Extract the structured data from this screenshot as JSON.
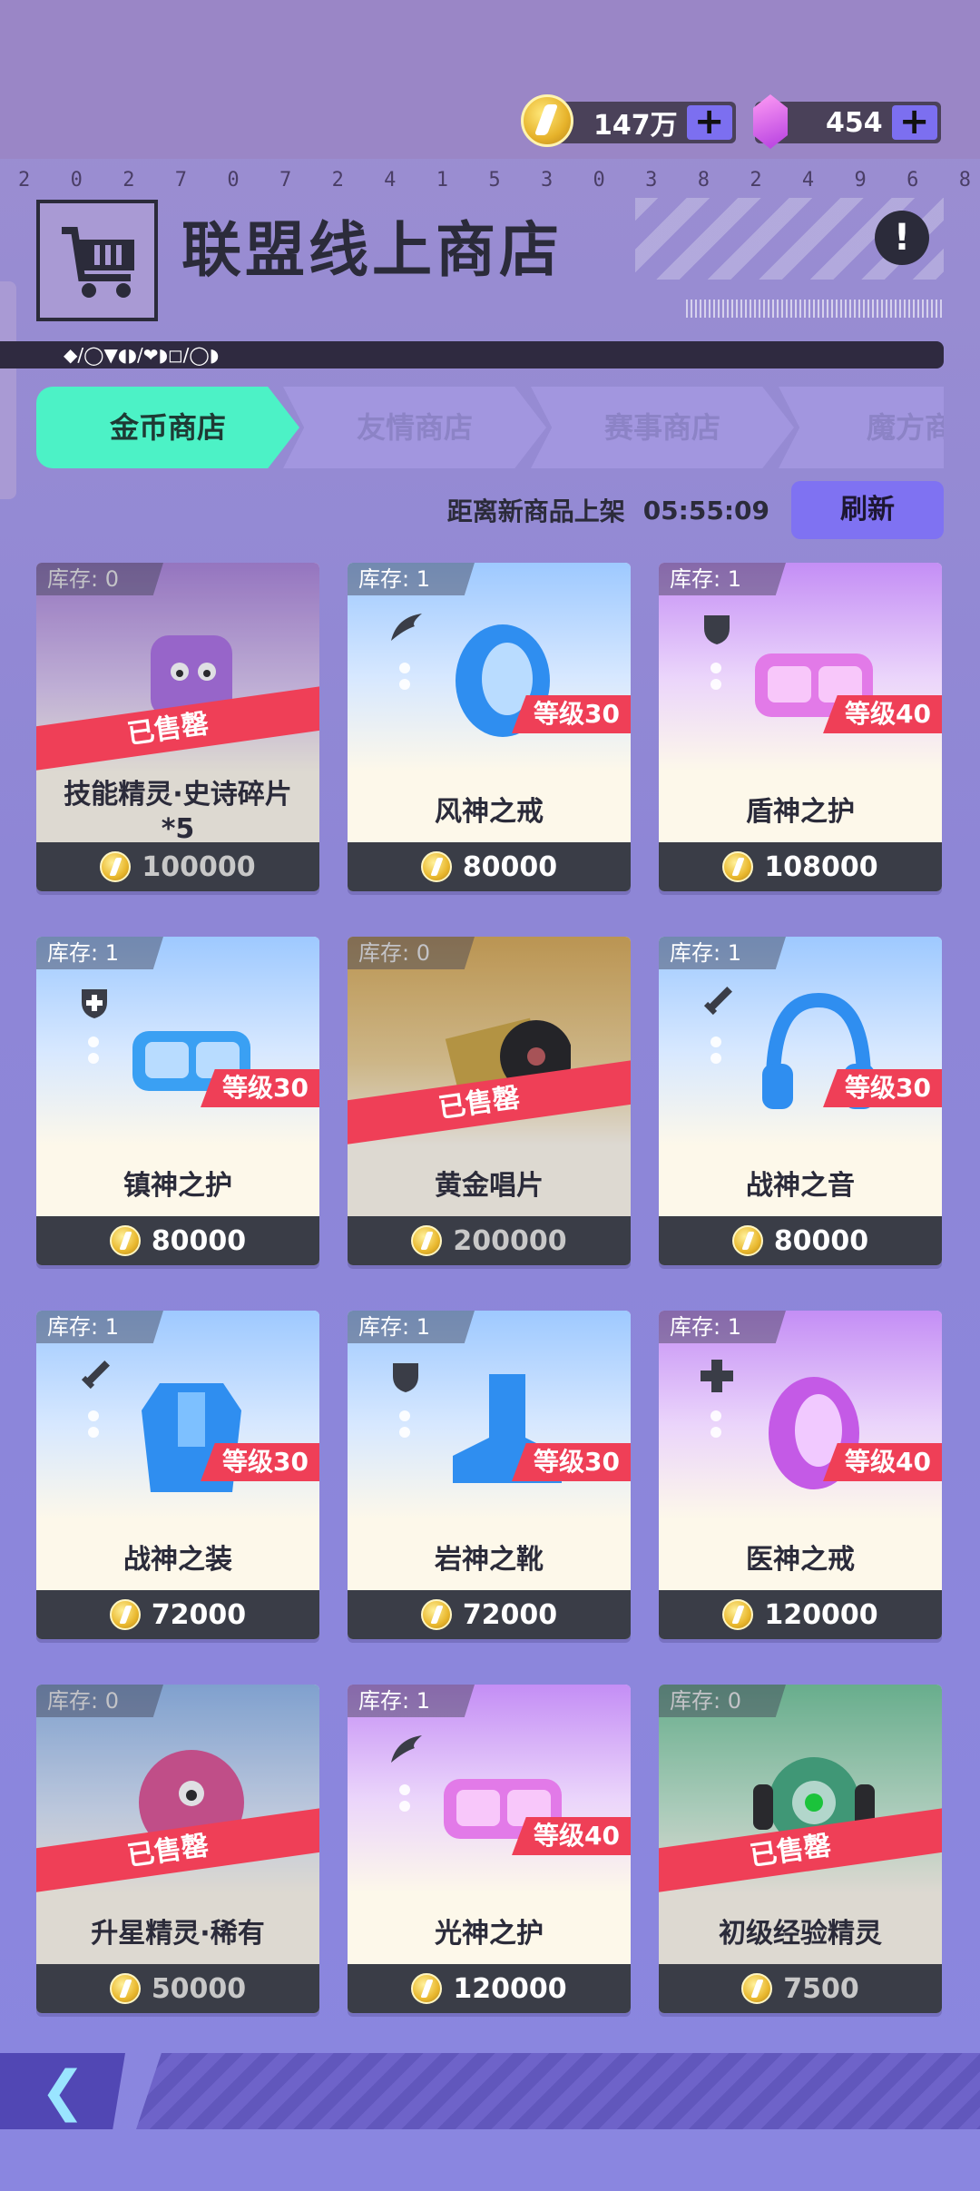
{
  "header": {
    "coins": "147万",
    "gems": "454",
    "serial_digits": [
      "2",
      "0",
      "2",
      "7",
      "0",
      "7",
      "2",
      "4",
      "1",
      "5",
      "3",
      "0",
      "3",
      "8",
      "2",
      "4",
      "9",
      "6",
      "8"
    ],
    "title": "联盟线上商店",
    "symbol_strip": "◆/◯▼◖◗/❤◗◻/◯◗"
  },
  "tabs": [
    {
      "label": "金币商店",
      "active": true
    },
    {
      "label": "友情商店",
      "active": false
    },
    {
      "label": "赛事商店",
      "active": false
    },
    {
      "label": "魔方商",
      "active": false
    }
  ],
  "refresh": {
    "label": "距离新商品上架",
    "countdown": "05:55:09",
    "button": "刷新"
  },
  "items": [
    {
      "stock": "库存: 0",
      "name": "技能精灵·史诗碎片*5",
      "price": "100000",
      "sold": true,
      "sold_label": "已售罄",
      "level": "",
      "bg": "violet"
    },
    {
      "stock": "库存: 1",
      "name": "风神之戒",
      "price": "80000",
      "sold": false,
      "level": "等级30",
      "bg": "blue"
    },
    {
      "stock": "库存: 1",
      "name": "盾神之护",
      "price": "108000",
      "sold": false,
      "level": "等级40",
      "bg": "purple"
    },
    {
      "stock": "库存: 1",
      "name": "镇神之护",
      "price": "80000",
      "sold": false,
      "level": "等级30",
      "bg": "blue"
    },
    {
      "stock": "库存: 0",
      "name": "黄金唱片",
      "price": "200000",
      "sold": true,
      "sold_label": "已售罄",
      "level": "",
      "bg": "gold"
    },
    {
      "stock": "库存: 1",
      "name": "战神之音",
      "price": "80000",
      "sold": false,
      "level": "等级30",
      "bg": "blue"
    },
    {
      "stock": "库存: 1",
      "name": "战神之装",
      "price": "72000",
      "sold": false,
      "level": "等级30",
      "bg": "blue"
    },
    {
      "stock": "库存: 1",
      "name": "岩神之靴",
      "price": "72000",
      "sold": false,
      "level": "等级30",
      "bg": "blue"
    },
    {
      "stock": "库存: 1",
      "name": "医神之戒",
      "price": "120000",
      "sold": false,
      "level": "等级40",
      "bg": "purple"
    },
    {
      "stock": "库存: 0",
      "name": "升星精灵·稀有",
      "price": "50000",
      "sold": true,
      "sold_label": "已售罄",
      "level": "",
      "bg": "sky"
    },
    {
      "stock": "库存: 1",
      "name": "光神之护",
      "price": "120000",
      "sold": false,
      "level": "等级40",
      "bg": "purple"
    },
    {
      "stock": "库存: 0",
      "name": "初级经验精灵",
      "price": "7500",
      "sold": true,
      "sold_label": "已售罄",
      "level": "",
      "bg": "green"
    }
  ],
  "colors": {
    "accent_tab": "#4cf2c6",
    "sold_band": "#ef3f57",
    "price_bar": "#3a3d47"
  }
}
